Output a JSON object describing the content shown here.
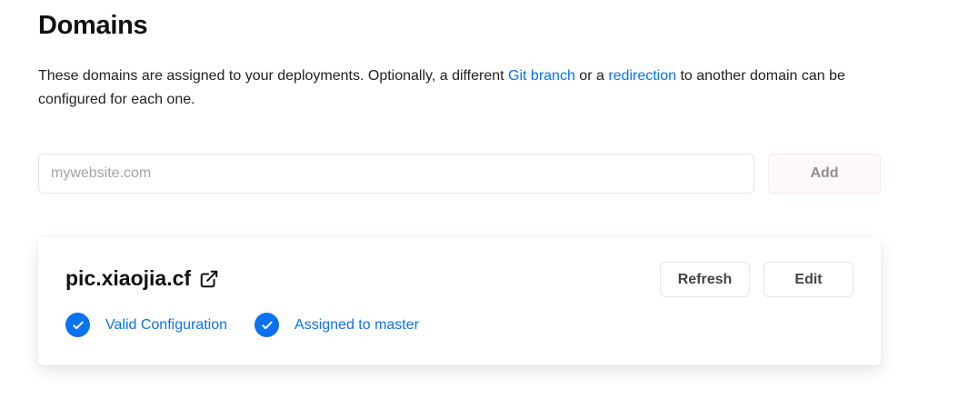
{
  "page": {
    "title": "Domains",
    "description_before_git": "These domains are assigned to your deployments. Optionally, a different ",
    "git_link": "Git branch",
    "description_middle": " or a ",
    "redirect_link": "redirection",
    "description_after": " to another domain can be configured for each one."
  },
  "add_domain": {
    "placeholder": "mywebsite.com",
    "value": "",
    "button_label": "Add"
  },
  "domain_card": {
    "domain": "pic.xiaojia.cf",
    "external_link_icon": "external-link-icon",
    "refresh_label": "Refresh",
    "edit_label": "Edit",
    "statuses": [
      {
        "label": "Valid Configuration",
        "icon": "check-circle-icon"
      },
      {
        "label": "Assigned to master",
        "icon": "check-circle-icon"
      }
    ]
  },
  "colors": {
    "accent": "#0a72ef",
    "text": "#111111",
    "muted": "#8f8f8f"
  }
}
